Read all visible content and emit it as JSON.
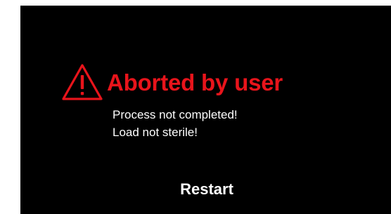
{
  "alert": {
    "icon": "warning-icon",
    "title": "Aborted by user",
    "messages": [
      "Process not completed!",
      "Load not sterile!"
    ]
  },
  "actions": {
    "restart_label": "Restart"
  },
  "colors": {
    "background": "#000000",
    "alert": "#e8141b",
    "text": "#ffffff"
  }
}
